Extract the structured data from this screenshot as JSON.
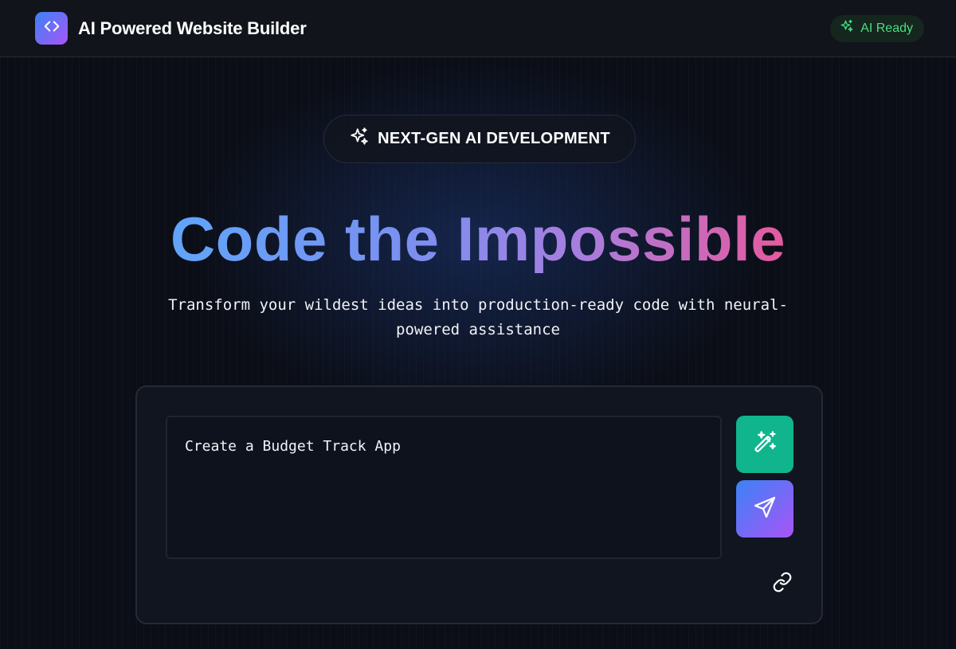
{
  "header": {
    "title": "AI Powered Website Builder",
    "logo_icon": "code-icon",
    "status_label": "AI Ready",
    "status_icon": "sparkles-icon",
    "status_color": "#4ade80"
  },
  "hero": {
    "badge_label": "NEXT-GEN AI DEVELOPMENT",
    "badge_icon": "sparkles-icon",
    "title": "Code the Impossible",
    "subtitle_line1": "Transform your wildest ideas into production-ready code with neural-",
    "subtitle_line2": "powered assistance"
  },
  "prompt": {
    "value": "Create a Budget Track App",
    "magic_icon": "magic-wand-icon",
    "send_icon": "send-icon",
    "link_icon": "link-icon"
  },
  "colors": {
    "accent_blue": "#3b82f6",
    "accent_purple": "#a855f7",
    "accent_green": "#10b58e",
    "background": "#0b0e17"
  }
}
